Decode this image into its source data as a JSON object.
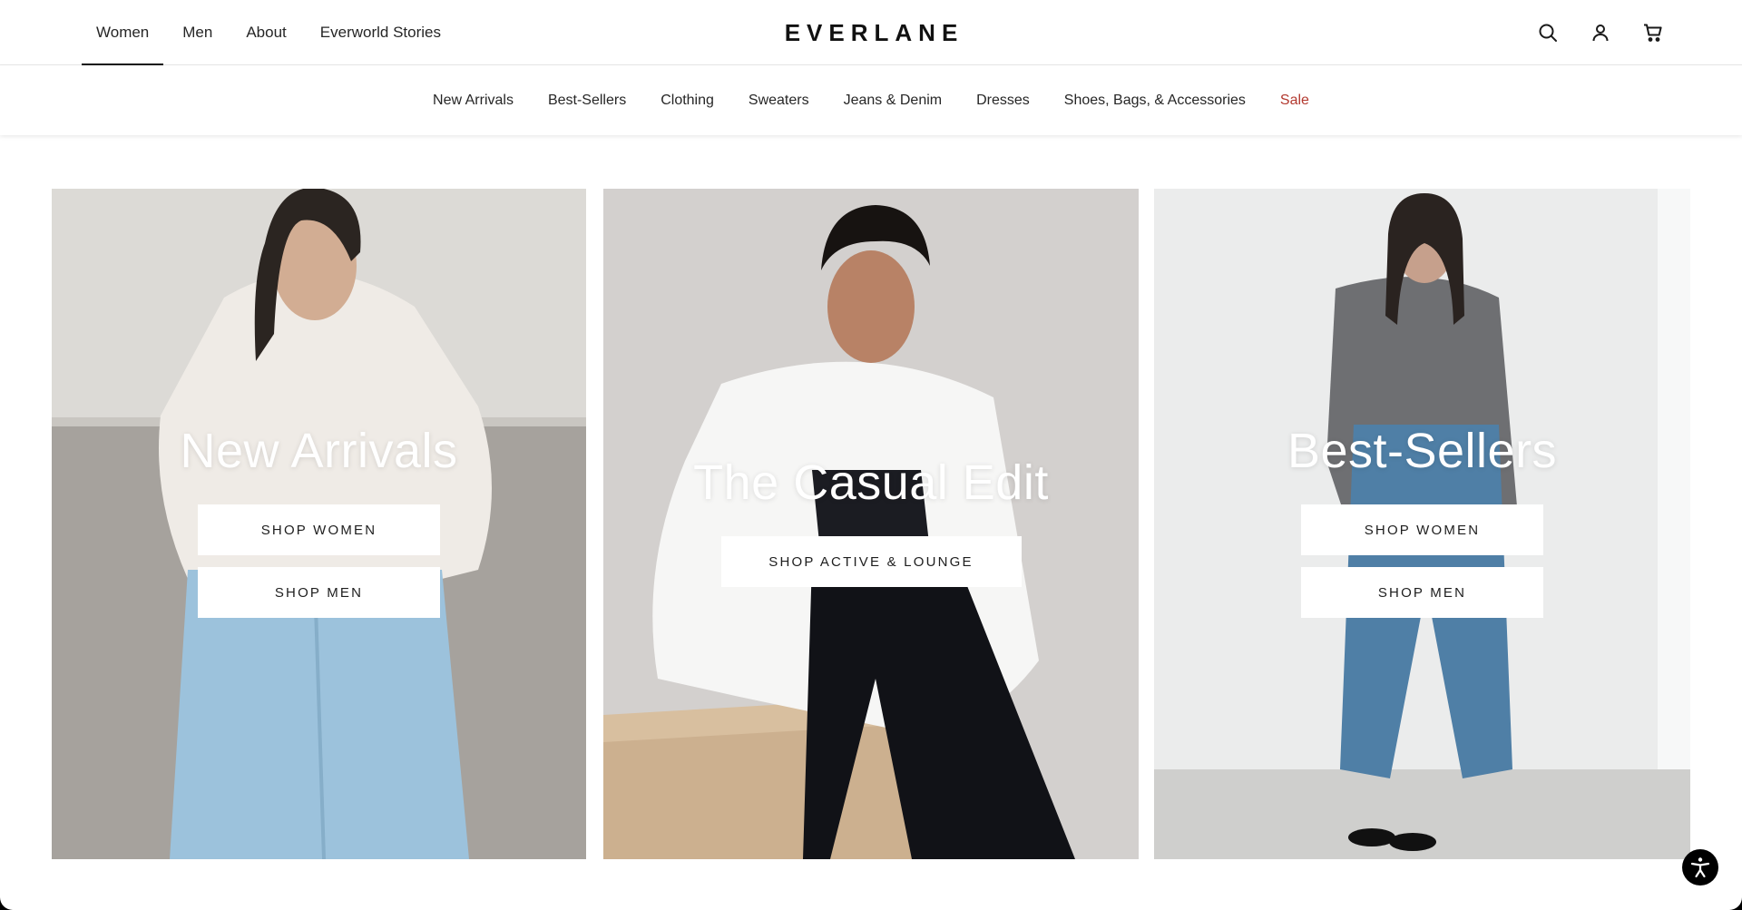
{
  "brand": {
    "logo": "EVERLANE"
  },
  "top_nav": {
    "items": [
      {
        "label": "Women",
        "active": true
      },
      {
        "label": "Men",
        "active": false
      },
      {
        "label": "About",
        "active": false
      },
      {
        "label": "Everworld Stories",
        "active": false
      }
    ]
  },
  "header_icons": [
    "search-icon",
    "account-icon",
    "cart-icon"
  ],
  "category_nav": {
    "items": [
      {
        "label": "New Arrivals"
      },
      {
        "label": "Best-Sellers"
      },
      {
        "label": "Clothing"
      },
      {
        "label": "Sweaters"
      },
      {
        "label": "Jeans & Denim"
      },
      {
        "label": "Dresses"
      },
      {
        "label": "Shoes, Bags, & Accessories"
      },
      {
        "label": "Sale",
        "highlight": true
      }
    ],
    "sale_color": "#b3392f"
  },
  "hero": {
    "panels": [
      {
        "title": "New Arrivals",
        "buttons": [
          "SHOP WOMEN",
          "SHOP MEN"
        ]
      },
      {
        "title": "The Casual Edit",
        "buttons": [
          "SHOP ACTIVE & LOUNGE"
        ]
      },
      {
        "title": "Best-Sellers",
        "buttons": [
          "SHOP WOMEN",
          "SHOP MEN"
        ]
      }
    ]
  },
  "accessibility": {
    "icon": "accessibility-icon"
  }
}
